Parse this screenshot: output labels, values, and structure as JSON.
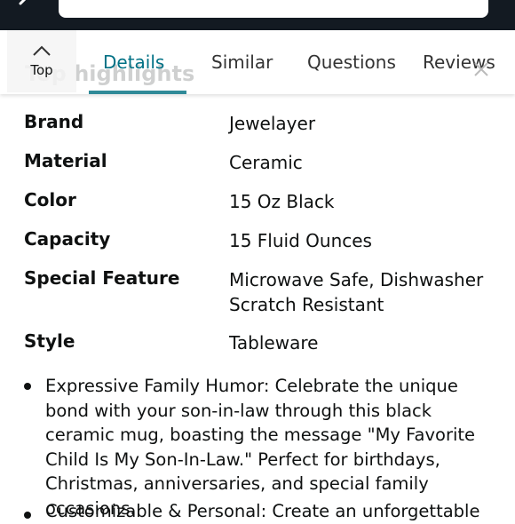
{
  "header": {
    "search_placeholder": ""
  },
  "tabs": {
    "top_label": "Top",
    "ghost_heading": "Top highlights",
    "items": [
      {
        "label": "Details"
      },
      {
        "label": "Similar"
      },
      {
        "label": "Questions"
      },
      {
        "label": "Reviews"
      }
    ],
    "active_index": 0
  },
  "specs": [
    {
      "key": "Brand",
      "value": "Jewelayer"
    },
    {
      "key": "Material",
      "value": "Ceramic"
    },
    {
      "key": "Color",
      "value": "15 Oz Black"
    },
    {
      "key": "Capacity",
      "value": "15 Fluid Ounces"
    },
    {
      "key": "Special Feature",
      "value": "Microwave Safe, Dishwasher Scratch Resistant"
    },
    {
      "key": "Style",
      "value": "Tableware"
    }
  ],
  "bullets": [
    {
      "text": "Expressive Family Humor: Celebrate the unique bond with your son-in-law through this black ceramic mug, boasting the message \"My Favorite Child Is My Son-In-Law.\" Perfect for birthdays, Christmas, anniversaries, and special family occasions."
    },
    {
      "text": "Customizable & Personal: Create an unforgettable"
    }
  ],
  "colors": {
    "header_bg": "#131a22",
    "active_tab": "#007185",
    "active_underline": "#2f8a98",
    "text": "#0f1111"
  }
}
